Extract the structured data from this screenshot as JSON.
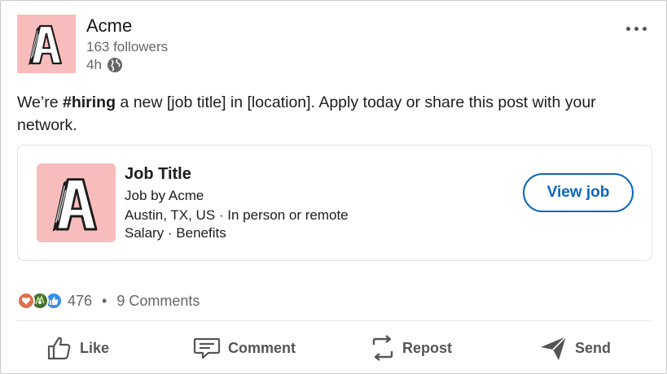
{
  "header": {
    "company_name": "Acme",
    "followers": "163 followers",
    "time": "4h",
    "logo_letter": "A",
    "logo_bg": "#f9bcbc"
  },
  "post": {
    "text_before": "We’re ",
    "hashtag": "#hiring",
    "text_after": " a new [job title] in [location]. Apply today or share this post with your network."
  },
  "job_card": {
    "title": "Job Title",
    "by": "Job by Acme",
    "location": "Austin, TX, US · In person or remote",
    "salary": "Salary · Benefits",
    "button_label": "View job",
    "accent": "#0a66c2"
  },
  "social": {
    "reaction_count": "476",
    "separator": "•",
    "comments": "9 Comments"
  },
  "actions": {
    "like": "Like",
    "comment": "Comment",
    "repost": "Repost",
    "send": "Send"
  }
}
